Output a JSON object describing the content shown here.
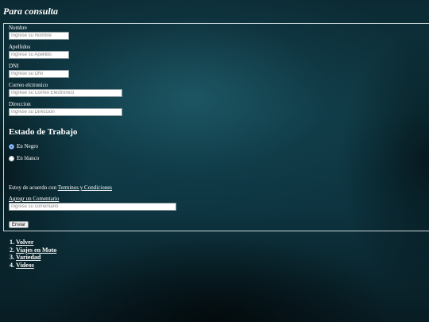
{
  "page": {
    "title": "Para consulta"
  },
  "form": {
    "nombre": {
      "label": "Nombre",
      "placeholder": "Ingrese su Nombre"
    },
    "apellidos": {
      "label": "Apellidos",
      "placeholder": "Ingrese su Apellido"
    },
    "dni": {
      "label": "DNI",
      "placeholder": "Ingrese su DNI"
    },
    "correo": {
      "label": "Correo elctronico",
      "placeholder": "Ingrese su Correo Electronico"
    },
    "direccion": {
      "label": "Direccion",
      "placeholder": "Ingrese su Direccion"
    },
    "estado": {
      "heading": "Estado de Trabajo",
      "options": [
        {
          "label": "En Negro",
          "checked": true
        },
        {
          "label": "En blanco",
          "checked": false
        }
      ]
    },
    "terms": {
      "text": "Estoy de acuerdo con",
      "link": "Terminos y Condiciones"
    },
    "comentario": {
      "label": "Agregr un Comentario",
      "placeholder": "Ingrese su comentario"
    },
    "submit_label": "Enviar"
  },
  "nav": {
    "items": [
      {
        "label": "Volver"
      },
      {
        "label": "Viajes en Moto"
      },
      {
        "label": "Variedad"
      },
      {
        "label": "Videos"
      }
    ]
  }
}
